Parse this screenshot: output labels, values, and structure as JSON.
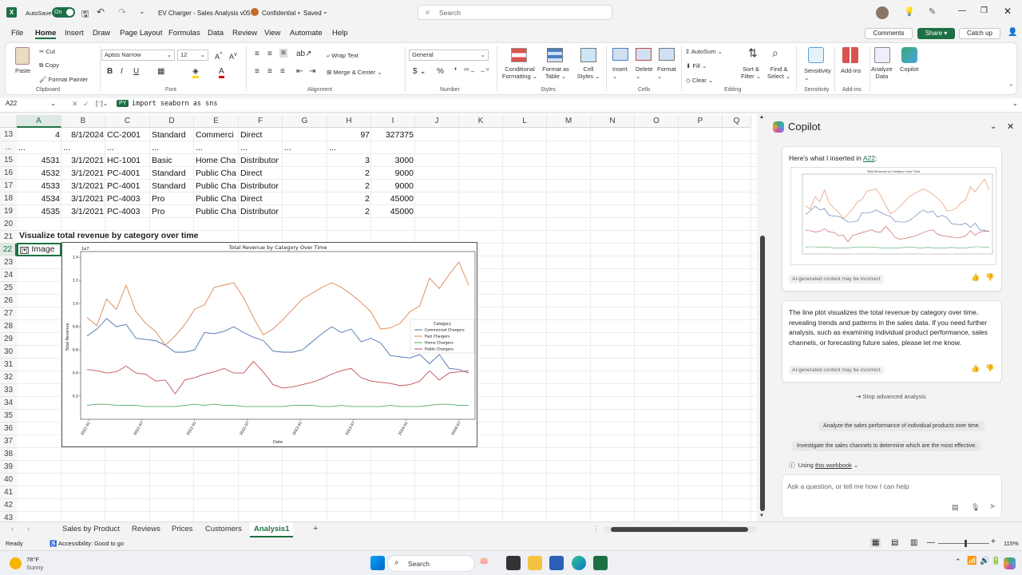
{
  "titlebar": {
    "autosave_label": "AutoSave",
    "autosave_state": "On",
    "doc_title": "EV Charger - Sales Analysis v05",
    "sensitivity": "Confidential",
    "saved": "Saved",
    "search_placeholder": "Search"
  },
  "menu": [
    "File",
    "Home",
    "Insert",
    "Draw",
    "Page Layout",
    "Formulas",
    "Data",
    "Review",
    "View",
    "Automate",
    "Help"
  ],
  "menu_right": {
    "comments": "Comments",
    "share": "Share",
    "catchup": "Catch up"
  },
  "ribbon": {
    "clipboard": {
      "label": "Clipboard",
      "paste": "Paste",
      "cut": "Cut",
      "copy": "Copy",
      "format_painter": "Format Painter"
    },
    "font": {
      "label": "Font",
      "name": "Aptos Narrow",
      "size": "12"
    },
    "alignment": {
      "label": "Alignment",
      "wrap": "Wrap Text",
      "merge": "Merge & Center"
    },
    "number": {
      "label": "Number",
      "format": "General"
    },
    "styles": {
      "label": "Styles",
      "cond": "Conditional",
      "cond2": "Formatting",
      "fmt_table": "Format as",
      "fmt_table2": "Table",
      "cell_styles": "Cell",
      "cell_styles2": "Styles"
    },
    "cells": {
      "label": "Cells",
      "insert": "Insert",
      "delete": "Delete",
      "format": "Format"
    },
    "editing": {
      "label": "Editing",
      "autosum": "AutoSum",
      "fill": "Fill",
      "clear": "Clear",
      "sort": "Sort &",
      "sort2": "Filter",
      "find": "Find &",
      "find2": "Select"
    },
    "sensitivity": {
      "label": "Sensitivity",
      "btn": "Sensitivity"
    },
    "addins": {
      "label": "Add-ins",
      "btn": "Add-ins"
    },
    "analyze": {
      "btn": "Analyze",
      "btn2": "Data"
    },
    "copilot": {
      "btn": "Copilot"
    }
  },
  "formula_bar": {
    "name_box": "A22",
    "py_badge": "PY",
    "formula": "import seaborn as sns"
  },
  "columns": [
    "A",
    "B",
    "C",
    "D",
    "E",
    "F",
    "G",
    "H",
    "I",
    "J",
    "K",
    "L",
    "M",
    "N",
    "O",
    "P",
    "Q"
  ],
  "rows": [
    {
      "num": "13",
      "cells": [
        "4",
        "8/1/2024",
        "CC-2001",
        "Standard",
        "Commerci",
        "Direct",
        "",
        "97",
        "327375"
      ]
    },
    {
      "num": "...",
      "cells": [
        "...",
        "...",
        "...",
        "...",
        "...",
        "...",
        "...",
        "...",
        ""
      ]
    },
    {
      "num": "15",
      "cells": [
        "4531",
        "3/1/2021",
        "HC-1001",
        "Basic",
        "Home Cha",
        "Distributor",
        "",
        "3",
        "3000"
      ]
    },
    {
      "num": "16",
      "cells": [
        "4532",
        "3/1/2021",
        "PC-4001",
        "Standard",
        "Public Cha",
        "Direct",
        "",
        "2",
        "9000"
      ]
    },
    {
      "num": "17",
      "cells": [
        "4533",
        "3/1/2021",
        "PC-4001",
        "Standard",
        "Public Cha",
        "Distributor",
        "",
        "2",
        "9000"
      ]
    },
    {
      "num": "18",
      "cells": [
        "4534",
        "3/1/2021",
        "PC-4003",
        "Pro",
        "Public Cha",
        "Direct",
        "",
        "2",
        "45000"
      ]
    },
    {
      "num": "19",
      "cells": [
        "4535",
        "3/1/2021",
        "PC-4003",
        "Pro",
        "Public Cha",
        "Distributor",
        "",
        "2",
        "45000"
      ]
    }
  ],
  "more_rows": [
    "20",
    "21",
    "22",
    "23",
    "24",
    "25",
    "26",
    "27",
    "28",
    "29",
    "30",
    "31",
    "32",
    "33",
    "34",
    "35",
    "36",
    "37",
    "38",
    "39",
    "40",
    "41",
    "42",
    "43"
  ],
  "row21_heading": "Visualize total revenue by category over time",
  "row22_cell": "Image",
  "chart_data": {
    "type": "line",
    "title": "Total Revenue by Category Over Time",
    "xlabel": "Date",
    "ylabel": "Total Revenue",
    "y_multiplier": "1e7",
    "ylim": [
      0.0,
      1.45
    ],
    "yticks": [
      "0.2",
      "0.4",
      "0.6",
      "0.8",
      "1.0",
      "1.2",
      "1.4"
    ],
    "xticks": [
      "2021-01",
      "2021-07",
      "2022-01",
      "2022-07",
      "2023-01",
      "2023-07",
      "2024-01",
      "2024-07"
    ],
    "legend_title": "Category",
    "legend_position": "center-right",
    "grid": false,
    "series": [
      {
        "name": "Commercial Chargers",
        "color": "#4c72b0",
        "values": [
          0.72,
          0.78,
          0.87,
          0.8,
          0.82,
          0.7,
          0.69,
          0.68,
          0.64,
          0.58,
          0.58,
          0.6,
          0.75,
          0.74,
          0.76,
          0.8,
          0.75,
          0.71,
          0.68,
          0.59,
          0.58,
          0.58,
          0.6,
          0.67,
          0.74,
          0.8,
          0.75,
          0.78,
          0.67,
          0.7,
          0.66,
          0.55,
          0.54,
          0.53,
          0.56,
          0.48,
          0.56,
          0.44,
          0.43,
          0.4
        ]
      },
      {
        "name": "Fast Chargers",
        "color": "#dd8452",
        "values": [
          0.88,
          0.81,
          1.04,
          0.95,
          1.16,
          0.93,
          0.83,
          0.76,
          0.64,
          0.72,
          0.82,
          0.95,
          0.99,
          1.14,
          1.16,
          1.18,
          1.05,
          0.88,
          0.73,
          0.78,
          0.86,
          0.95,
          1.04,
          1.09,
          1.14,
          1.18,
          1.14,
          1.08,
          1.01,
          0.93,
          0.78,
          0.79,
          0.83,
          0.93,
          0.98,
          1.22,
          1.13,
          1.25,
          1.36,
          1.16
        ]
      },
      {
        "name": "Home Chargers",
        "color": "#55a868",
        "values": [
          0.12,
          0.13,
          0.13,
          0.12,
          0.12,
          0.12,
          0.11,
          0.11,
          0.11,
          0.11,
          0.12,
          0.13,
          0.12,
          0.13,
          0.12,
          0.12,
          0.11,
          0.11,
          0.11,
          0.11,
          0.11,
          0.12,
          0.12,
          0.12,
          0.11,
          0.11,
          0.12,
          0.11,
          0.11,
          0.11,
          0.11,
          0.12,
          0.11,
          0.11,
          0.11,
          0.12,
          0.13,
          0.13,
          0.12,
          0.12
        ]
      },
      {
        "name": "Public Chargers",
        "color": "#c44e52",
        "values": [
          0.43,
          0.42,
          0.4,
          0.41,
          0.46,
          0.4,
          0.39,
          0.33,
          0.34,
          0.22,
          0.34,
          0.36,
          0.39,
          0.41,
          0.44,
          0.4,
          0.4,
          0.5,
          0.41,
          0.3,
          0.27,
          0.28,
          0.3,
          0.32,
          0.35,
          0.39,
          0.42,
          0.44,
          0.36,
          0.33,
          0.32,
          0.31,
          0.29,
          0.3,
          0.33,
          0.42,
          0.34,
          0.4,
          0.41,
          0.42
        ]
      }
    ]
  },
  "copilot": {
    "title": "Copilot",
    "inserted_prefix": "Here's what I inserted in ",
    "inserted_ref": "A22",
    "inserted_suffix": ":",
    "ai_tag": "AI-generated content may be incorrect",
    "message": "The line plot visualizes the total revenue by category over time, revealing trends and patterns in the sales data. If you need further analysis, such as examining individual product performance, sales channels, or forecasting future sales, please let me know.",
    "stop": "Stop advanced analysis",
    "suggestions": [
      "Analyze the sales performance of individual products over time.",
      "Investigate the sales channels to determine which are the most effective."
    ],
    "using_prefix": "Using ",
    "using_link": "this workbook",
    "input_placeholder": "Ask a question, or tell me how I can help"
  },
  "sheet_tabs": [
    "Sales by Product",
    "Reviews",
    "Prices",
    "Customers",
    "Analysis1"
  ],
  "active_tab": "Analysis1",
  "status": {
    "ready": "Ready",
    "accessibility": "Accessibility: Good to go",
    "zoom": "115%"
  },
  "taskbar": {
    "temp": "78°F",
    "weather": "Sunny",
    "search": "Search"
  }
}
